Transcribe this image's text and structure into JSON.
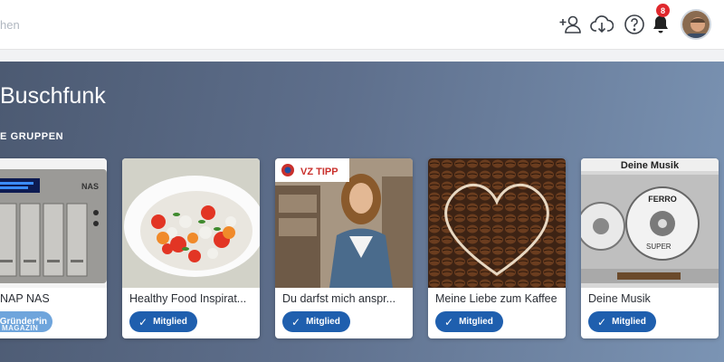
{
  "header": {
    "search_placeholder": "hen",
    "notification_count": "8"
  },
  "main": {
    "title": "Buschfunk",
    "section_label": "E GRUPPEN"
  },
  "colors": {
    "member_button": "#1f5fae",
    "founder_button": "#6fa5dc",
    "badge": "#e0282d"
  },
  "groups": [
    {
      "title": "NAP NAS",
      "button": "Gründer*in",
      "image_icon": "nas-device-image"
    },
    {
      "title": "Healthy Food Inspirat...",
      "button": "Mitglied",
      "image_icon": "salad-bowl-image"
    },
    {
      "title": "Du darfst mich anspr...",
      "button": "Mitglied",
      "image_icon": "smiling-woman-image",
      "image_label": "VZ TIPP"
    },
    {
      "title": "Meine Liebe zum Kaffee",
      "button": "Mitglied",
      "image_icon": "coffee-heart-image"
    },
    {
      "title": "Deine Musik",
      "button": "Mitglied",
      "image_icon": "cassette-tape-image",
      "image_label": "Deine Musik"
    }
  ],
  "extra": {
    "nas_label": "NAS",
    "cassette_label": "FERRO",
    "cassette_label_2": "SUPER",
    "magazin_watermark": "MAGAZIN"
  }
}
